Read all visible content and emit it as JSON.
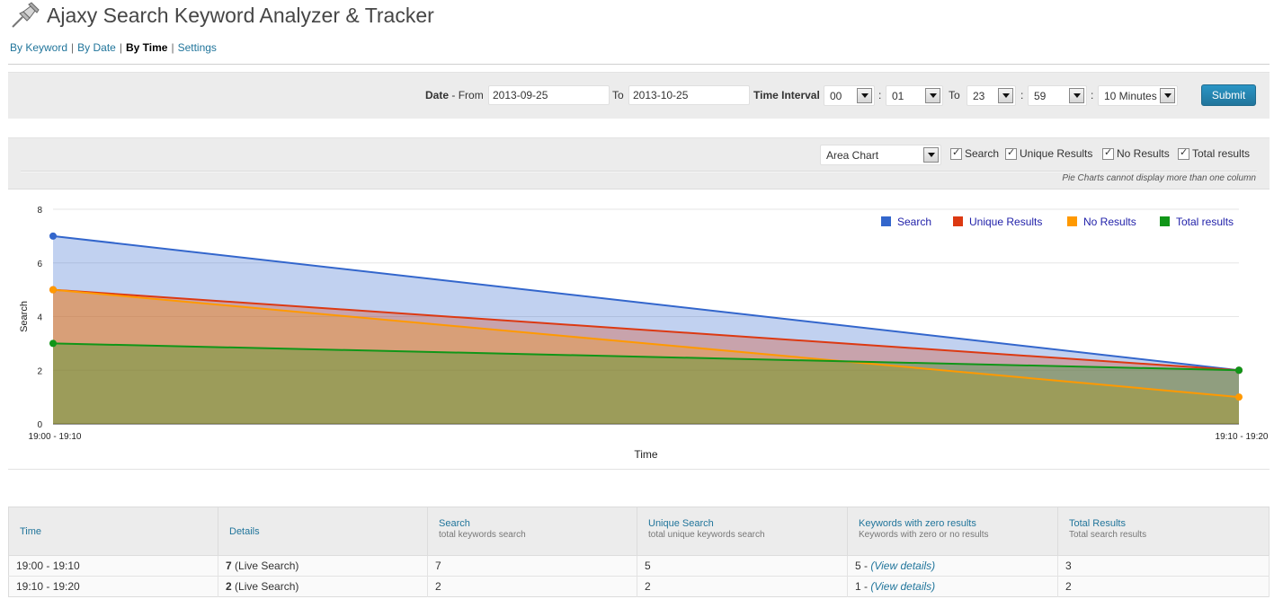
{
  "header": {
    "title": "Ajaxy Search Keyword Analyzer & Tracker",
    "icon": "pushpin-icon"
  },
  "subnav": {
    "items": [
      {
        "label": "By Keyword",
        "active": false
      },
      {
        "label": "By Date",
        "active": false
      },
      {
        "label": "By Time",
        "active": true
      },
      {
        "label": "Settings",
        "active": false
      }
    ],
    "separator": "|"
  },
  "filter": {
    "date_label": "Date",
    "from_label": "- From",
    "from_value": "2013-09-25",
    "to_label": "To",
    "to_value": "2013-10-25",
    "time_interval_label": "Time Interval",
    "start_hour": "00",
    "start_minute": "01",
    "time_to_label": "To",
    "end_hour": "23",
    "end_minute": "59",
    "colon": ":",
    "interval": "10 Minutes",
    "submit_label": "Submit"
  },
  "chart_options": {
    "chart_type": "Area Chart",
    "checkboxes": [
      {
        "label": "Search",
        "checked": true
      },
      {
        "label": "Unique Results",
        "checked": true
      },
      {
        "label": "No Results",
        "checked": true
      },
      {
        "label": "Total results",
        "checked": true
      }
    ],
    "note": "Pie Charts cannot display more than one column"
  },
  "chart_data": {
    "type": "area",
    "x": [
      "19:00 - 19:10",
      "19:10 - 19:20"
    ],
    "xlabel": "Time",
    "ylabel": "Search",
    "ylim": [
      0,
      8
    ],
    "yticks": [
      0,
      2,
      4,
      6,
      8
    ],
    "grid": true,
    "legend_position": "top-right",
    "series": [
      {
        "name": "Search",
        "values": [
          7,
          2
        ],
        "color": "#3366cc"
      },
      {
        "name": "Unique Results",
        "values": [
          5,
          2
        ],
        "color": "#dc3912"
      },
      {
        "name": "No Results",
        "values": [
          5,
          1
        ],
        "color": "#ff9900"
      },
      {
        "name": "Total results",
        "values": [
          3,
          2
        ],
        "color": "#109618"
      }
    ]
  },
  "table": {
    "headers": [
      {
        "title": "Time",
        "sub": ""
      },
      {
        "title": "Details",
        "sub": ""
      },
      {
        "title": "Search",
        "sub": "total keywords search"
      },
      {
        "title": "Unique Search",
        "sub": "total unique keywords search"
      },
      {
        "title": "Keywords with zero results",
        "sub": "Keywords with zero or no results"
      },
      {
        "title": "Total Results",
        "sub": "Total search results"
      }
    ],
    "rows": [
      {
        "time": "19:00 - 19:10",
        "details_count": "7",
        "details_text": "(Live Search)",
        "search": "7",
        "unique": "5",
        "zero_count": "5 -",
        "zero_link": "(View details)",
        "total": "3"
      },
      {
        "time": "19:10 - 19:20",
        "details_count": "2",
        "details_text": "(Live Search)",
        "search": "2",
        "unique": "2",
        "zero_count": "1 -",
        "zero_link": "(View details)",
        "total": "2"
      }
    ]
  }
}
